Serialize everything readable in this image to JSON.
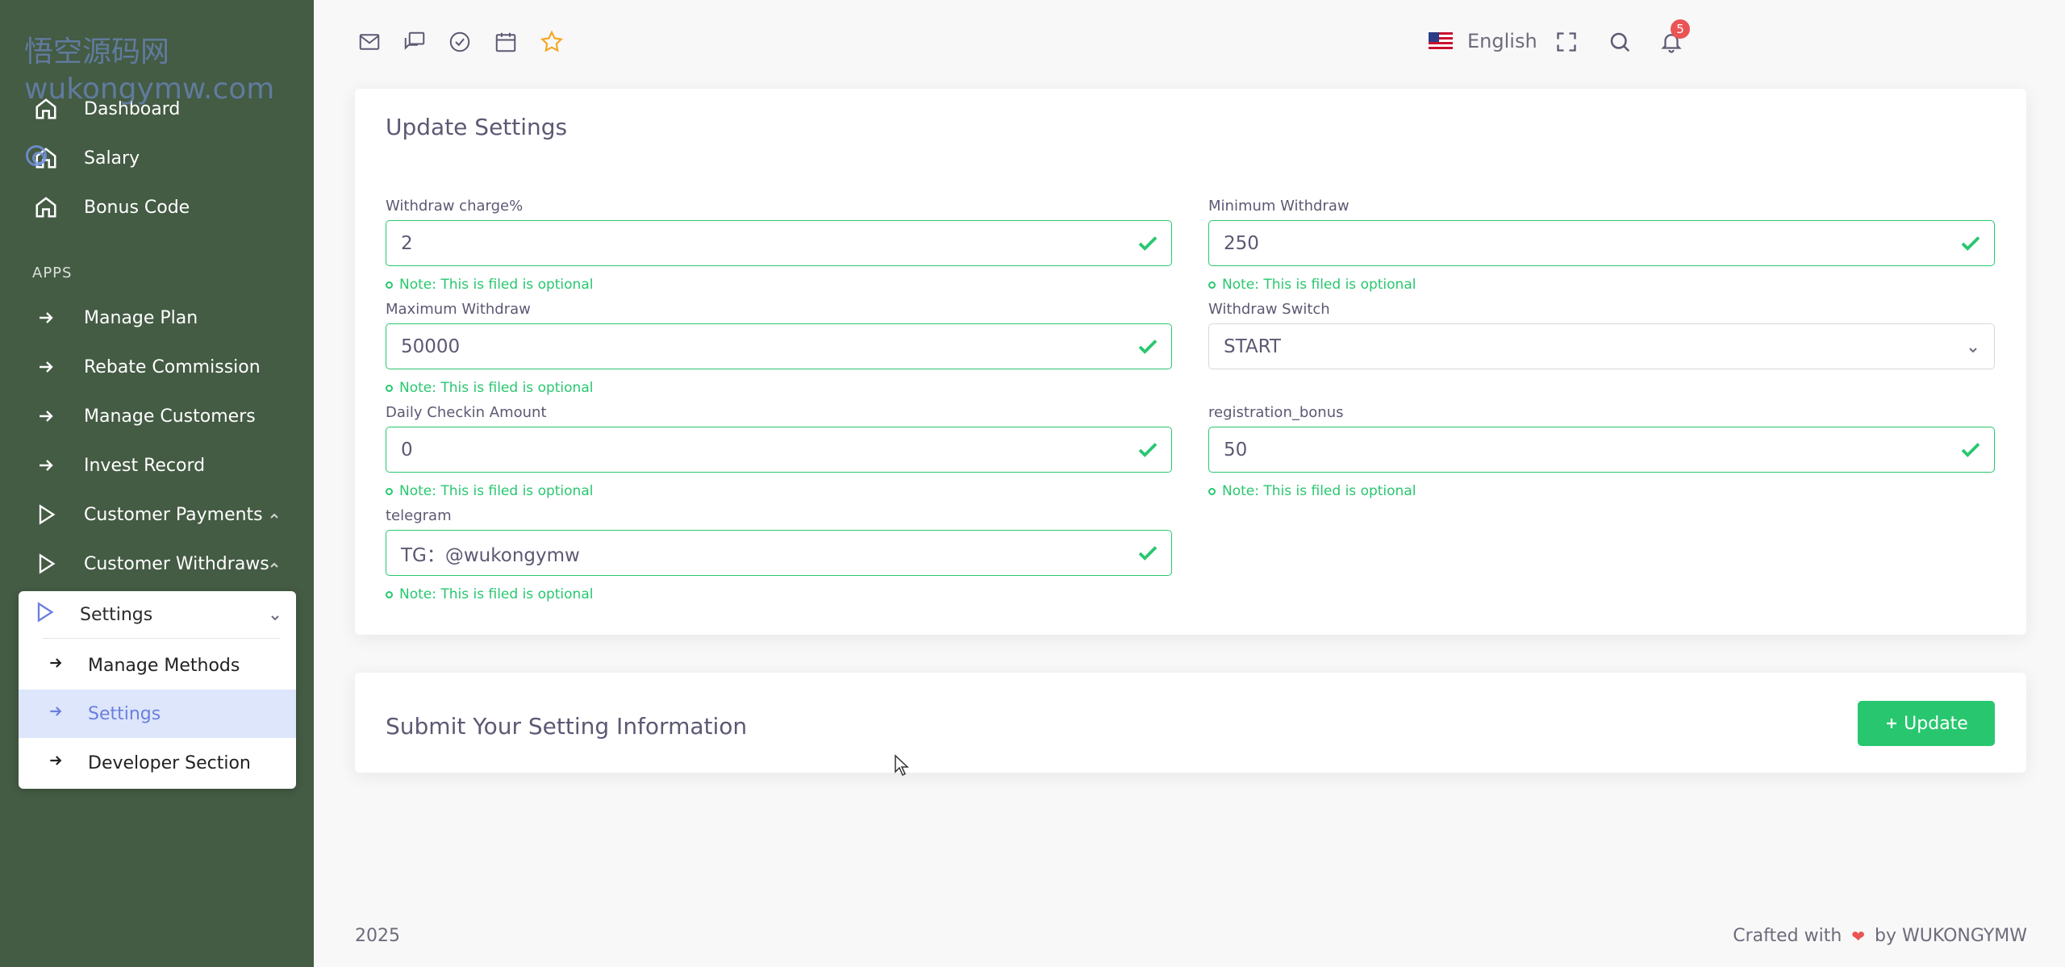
{
  "watermark": {
    "line1": "悟空源码网",
    "line2": "wukongymw.com"
  },
  "sidebar": {
    "items": [
      {
        "label": "Dashboard"
      },
      {
        "label": "Salary"
      },
      {
        "label": "Bonus Code"
      }
    ],
    "section_label": "APPS",
    "apps": [
      {
        "label": "Manage Plan"
      },
      {
        "label": "Rebate Commission"
      },
      {
        "label": "Manage Customers"
      },
      {
        "label": "Invest Record"
      },
      {
        "label": "Customer Payments"
      },
      {
        "label": "Customer Withdraws"
      }
    ],
    "settings_group": {
      "label": "Settings",
      "children": [
        {
          "label": "Manage Methods"
        },
        {
          "label": "Settings"
        },
        {
          "label": "Developer Section"
        }
      ]
    }
  },
  "topbar": {
    "language": "English",
    "notification_count": "5"
  },
  "form": {
    "title": "Update Settings",
    "note": "Note: This is filed is optional",
    "fields": {
      "withdraw_charge": {
        "label": "Withdraw charge%",
        "value": "2"
      },
      "minimum_withdraw": {
        "label": "Minimum Withdraw",
        "value": "250"
      },
      "maximum_withdraw": {
        "label": "Maximum Withdraw",
        "value": "50000"
      },
      "withdraw_switch": {
        "label": "Withdraw Switch",
        "value": "START"
      },
      "daily_checkin": {
        "label": "Daily Checkin Amount",
        "value": "0"
      },
      "registration_bonus": {
        "label": "registration_bonus",
        "value": "50"
      },
      "telegram": {
        "label": "telegram",
        "value": "TG：@wukongymw"
      }
    }
  },
  "submit": {
    "title": "Submit Your Setting Information",
    "button_label": "Update"
  },
  "footer": {
    "year": "2025",
    "crafted_prefix": "Crafted with",
    "crafted_suffix": "by WUKONGYMW"
  },
  "colors": {
    "sidebar_bg": "#445b44",
    "success": "#28c76f",
    "danger": "#ea5455",
    "active_bg": "#dde6fa",
    "active_text": "#6c7fe0",
    "star": "#f5a623"
  }
}
